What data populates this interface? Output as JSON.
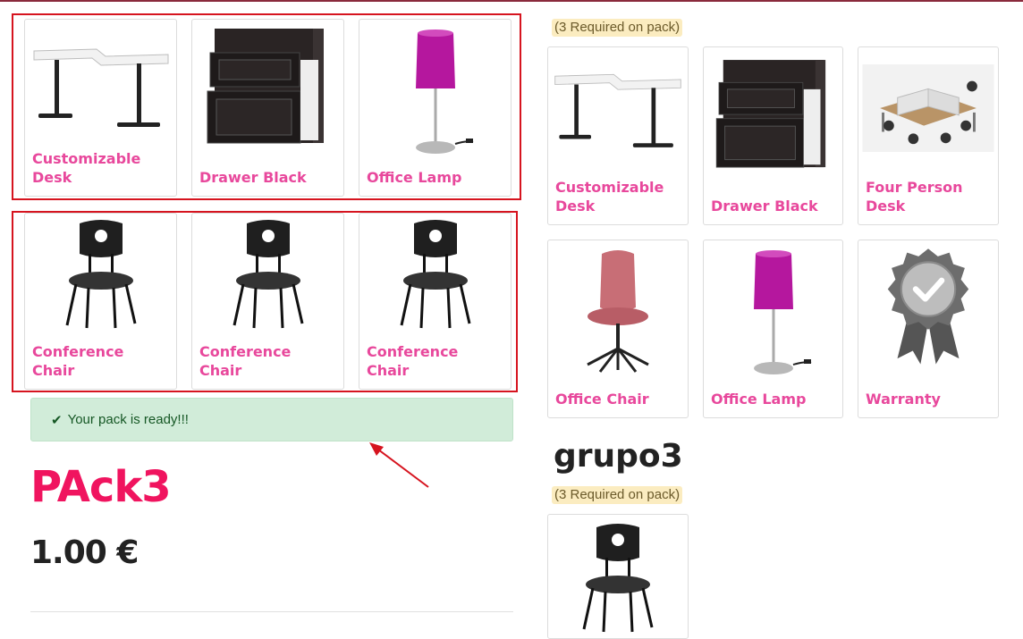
{
  "selected_products": [
    {
      "name": "Customizable Desk",
      "icon": "desk-icon"
    },
    {
      "name": "Drawer Black",
      "icon": "drawer-icon"
    },
    {
      "name": "Office Lamp",
      "icon": "lamp-icon"
    },
    {
      "name": "Conference Chair",
      "icon": "conference-chair-icon"
    },
    {
      "name": "Conference Chair",
      "icon": "conference-chair-icon"
    },
    {
      "name": "Conference Chair",
      "icon": "conference-chair-icon"
    }
  ],
  "alert": {
    "icon": "check-icon",
    "text": "Your pack is ready!!!"
  },
  "pack": {
    "title": "PAck3",
    "price": "1.00 €"
  },
  "group1": {
    "required_text": "(3 Required on pack)",
    "products": [
      {
        "name": "Customizable Desk",
        "icon": "desk-icon"
      },
      {
        "name": "Drawer Black",
        "icon": "drawer-icon"
      },
      {
        "name": "Four Person Desk",
        "icon": "four-person-desk-icon"
      },
      {
        "name": "Office Chair",
        "icon": "office-chair-icon"
      },
      {
        "name": "Office Lamp",
        "icon": "lamp-icon"
      },
      {
        "name": "Warranty",
        "icon": "warranty-badge-icon"
      }
    ]
  },
  "group2": {
    "name": "grupo3",
    "required_text": "(3 Required on pack)",
    "products": [
      {
        "name": "",
        "icon": "conference-chair-icon"
      }
    ]
  },
  "colors": {
    "accent": "#e8489c",
    "title": "#f0145f",
    "selection": "#d6141f",
    "alert_bg": "#d1ecd9"
  }
}
